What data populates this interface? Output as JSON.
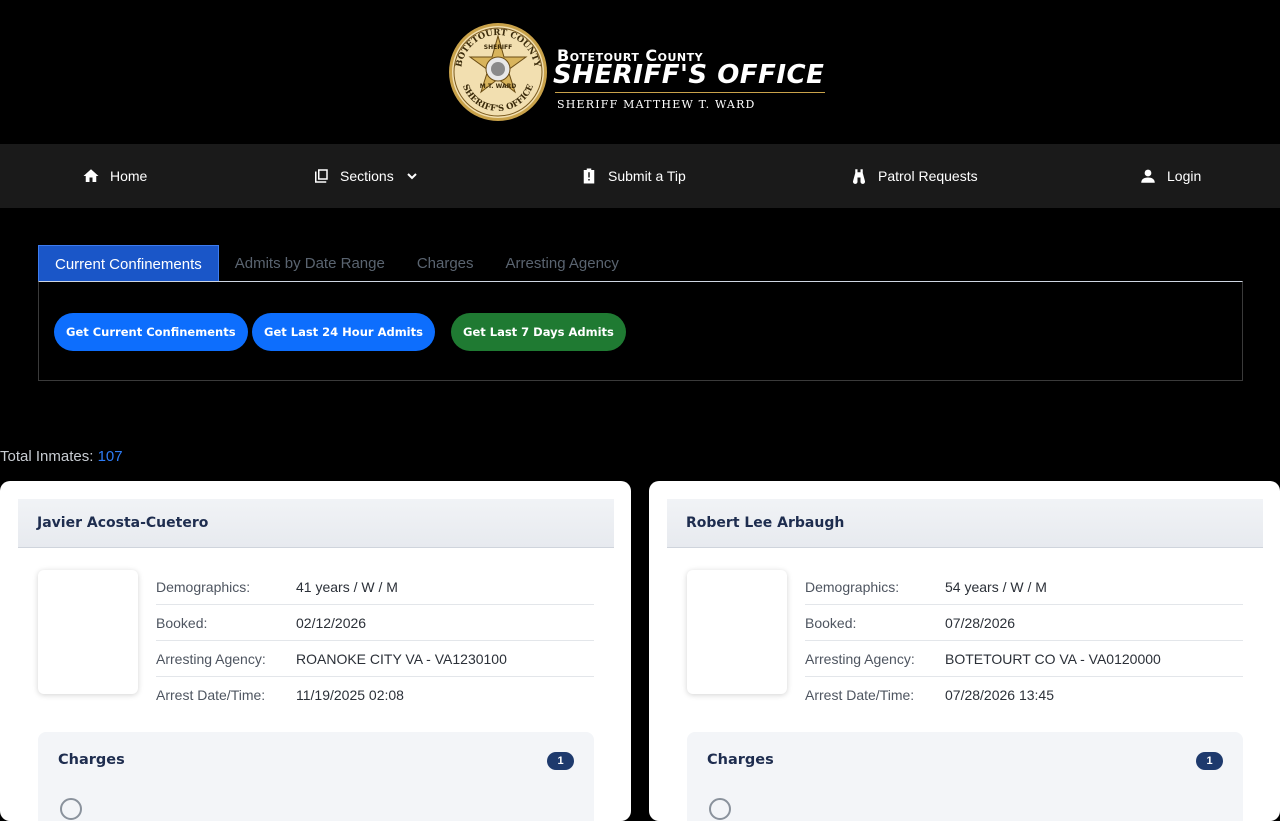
{
  "header": {
    "brand_line1": "Botetourt County",
    "brand_line2": "SHERIFF'S OFFICE",
    "brand_line3": "SHERIFF MATTHEW T. WARD",
    "seal": {
      "top_text": "BOTETOURT COUNTY",
      "inner_text": "SHERIFF",
      "name": "M.T. WARD",
      "bottom_text": "SHERIFF'S OFFICE"
    },
    "colors": {
      "gold": "#c9a24a",
      "background": "#000000"
    }
  },
  "nav": {
    "items": [
      {
        "label": "Home",
        "icon": "home-icon"
      },
      {
        "label": "Sections",
        "icon": "book-icon",
        "has_dropdown": true
      },
      {
        "label": "Submit a Tip",
        "icon": "clipboard-alert-icon"
      },
      {
        "label": "Patrol Requests",
        "icon": "binoculars-icon"
      },
      {
        "label": "Login",
        "icon": "user-icon"
      }
    ]
  },
  "tabs": [
    {
      "label": "Current Confinements",
      "active": true
    },
    {
      "label": "Admits by Date Range",
      "active": false
    },
    {
      "label": "Charges",
      "active": false
    },
    {
      "label": "Arresting Agency",
      "active": false
    }
  ],
  "actions": {
    "current": "Get Current Confinements",
    "last24": "Get Last 24 Hour Admits",
    "last7": "Get Last 7 Days Admits"
  },
  "total": {
    "label": "Total Inmates:",
    "count": "107"
  },
  "labels": {
    "demographics": "Demographics:",
    "booked": "Booked:",
    "agency": "Arresting Agency:",
    "arrest": "Arrest Date/Time:",
    "charges": "Charges"
  },
  "inmates": [
    {
      "name": "Javier Acosta-Cuetero",
      "demographics": "41 years / W / M",
      "booked": "02/12/2026",
      "agency": "ROANOKE CITY VA - VA1230100",
      "arrest": "11/19/2025 02:08",
      "charge_count": "1"
    },
    {
      "name": "Robert Lee Arbaugh",
      "demographics": "54 years / W / M",
      "booked": "07/28/2026",
      "agency": "BOTETOURT CO VA - VA0120000",
      "arrest": "07/28/2026 13:45",
      "charge_count": "1"
    }
  ]
}
